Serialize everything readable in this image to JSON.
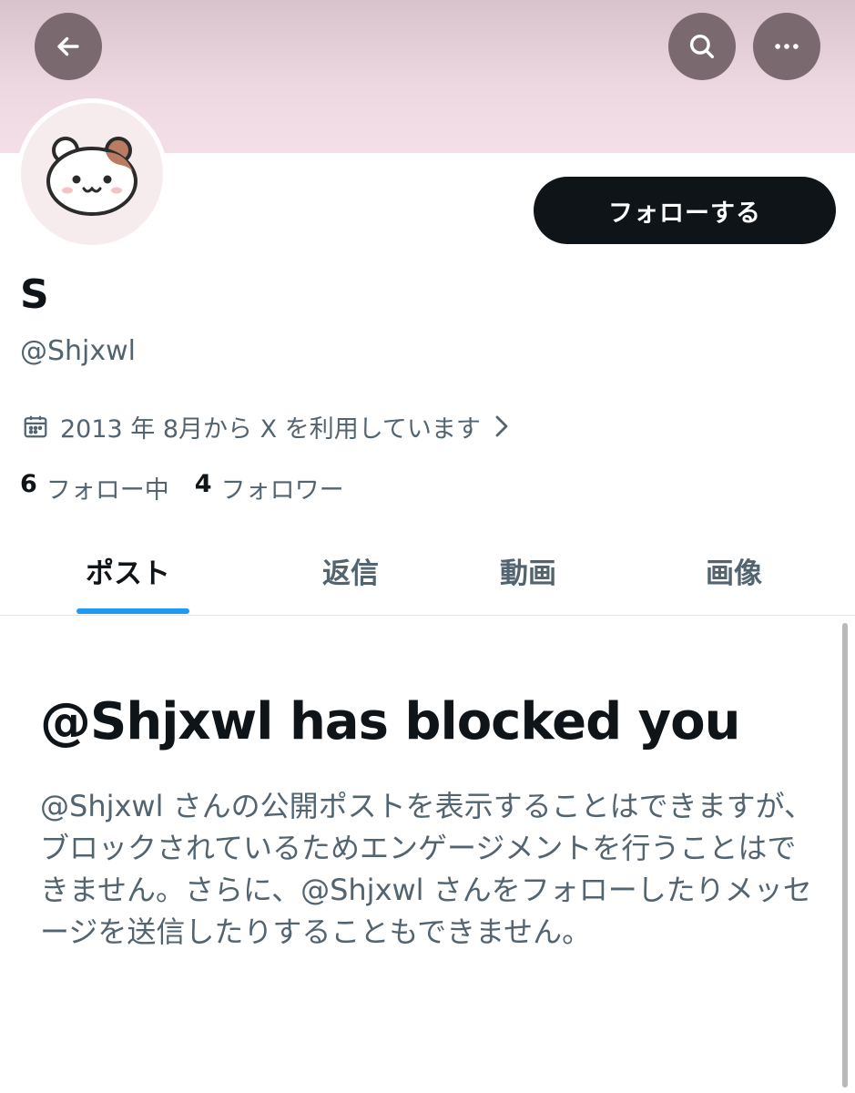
{
  "header": {
    "back_icon": "arrow-left-icon",
    "search_icon": "search-icon",
    "more_icon": "more-horizontal-icon",
    "banner_color": "#eed8e1"
  },
  "profile": {
    "avatar_icon": "hamster-face-avatar",
    "follow_label": "フォローする",
    "display_name": "S",
    "handle": "@Shjxwl",
    "joined": "2013 年 8月から X を利用しています",
    "following_count": "6",
    "following_label": "フォロー中",
    "followers_count": "4",
    "followers_label": "フォロワー"
  },
  "tabs": [
    {
      "label": "ポスト",
      "active": true
    },
    {
      "label": "返信",
      "active": false
    },
    {
      "label": "動画",
      "active": false
    },
    {
      "label": "画像",
      "active": false
    }
  ],
  "blocked": {
    "title": "@Shjxwl has blocked you",
    "body": "@Shjxwl さんの公開ポストを表示することはできますが、ブロックされているためエンゲージメントを行うことはできません。さらに、@Shjxwl さんをフォローしたりメッセージを送信したりすることもできません。"
  },
  "colors": {
    "accent": "#1d9bf0",
    "text_primary": "#0f1419",
    "text_secondary": "#536471"
  }
}
